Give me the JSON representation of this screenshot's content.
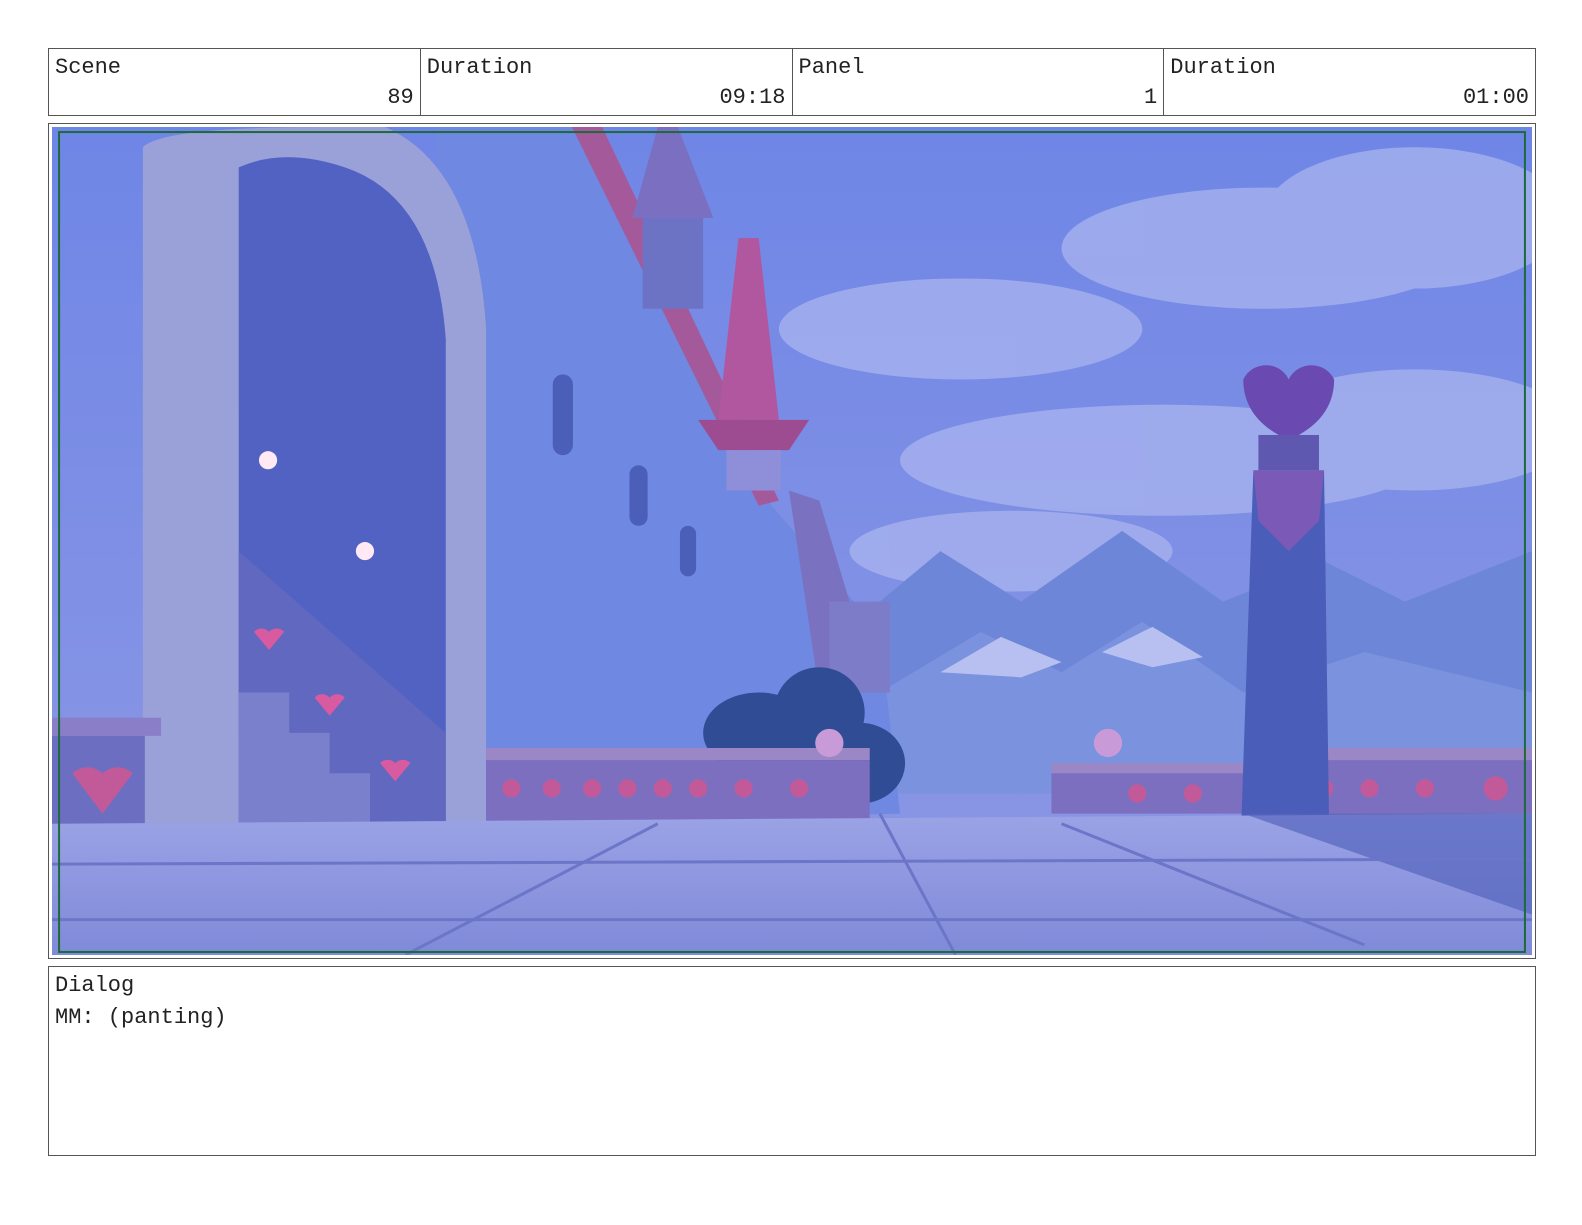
{
  "header": {
    "scene_label": "Scene",
    "scene_value": "89",
    "scene_duration_label": "Duration",
    "scene_duration_value": "09:18",
    "panel_label": "Panel",
    "panel_value": "1",
    "panel_duration_label": "Duration",
    "panel_duration_value": "01:00"
  },
  "panel_image": {
    "subject": "castle-balcony-illustration",
    "colors": {
      "sky": "#7f8fe0",
      "cloud": "#a9b4ef",
      "mountain": "#6e86d8",
      "wall": "#6f88e2",
      "arch": "#9aa0d8",
      "floor": "#8a96e0",
      "accent": "#c25a9a",
      "safe_frame": "#1d6b3a"
    }
  },
  "dialog": {
    "label": "Dialog",
    "text": "MM: (panting)"
  }
}
